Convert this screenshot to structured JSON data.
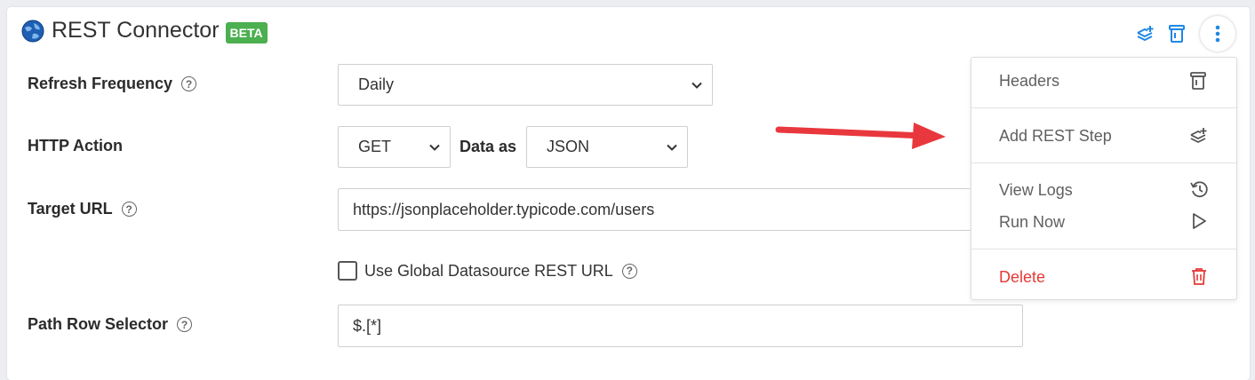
{
  "header": {
    "title": "REST Connector",
    "badge": "BETA"
  },
  "form": {
    "refresh_label": "Refresh Frequency",
    "refresh_value": "Daily",
    "http_label": "HTTP Action",
    "http_value": "GET",
    "data_as_label": "Data as",
    "data_as_value": "JSON",
    "target_label": "Target URL",
    "target_value": "https://jsonplaceholder.typicode.com/users",
    "global_checkbox_label": "Use Global Datasource REST URL",
    "global_checked": false,
    "path_label": "Path Row Selector",
    "path_value": "$.[*]",
    "help_glyph": "?"
  },
  "menu": {
    "items": [
      {
        "label": "Headers",
        "icon": "headers-icon"
      },
      {
        "label": "Add REST Step",
        "icon": "add-step-icon"
      },
      {
        "label": "View Logs",
        "icon": "history-icon"
      },
      {
        "label": "Run Now",
        "icon": "play-icon"
      },
      {
        "label": "Delete",
        "icon": "trash-icon"
      }
    ]
  },
  "colors": {
    "accent": "#1e88e5",
    "beta": "#4caf50",
    "danger": "#e53935",
    "arrow": "#e8383d"
  }
}
